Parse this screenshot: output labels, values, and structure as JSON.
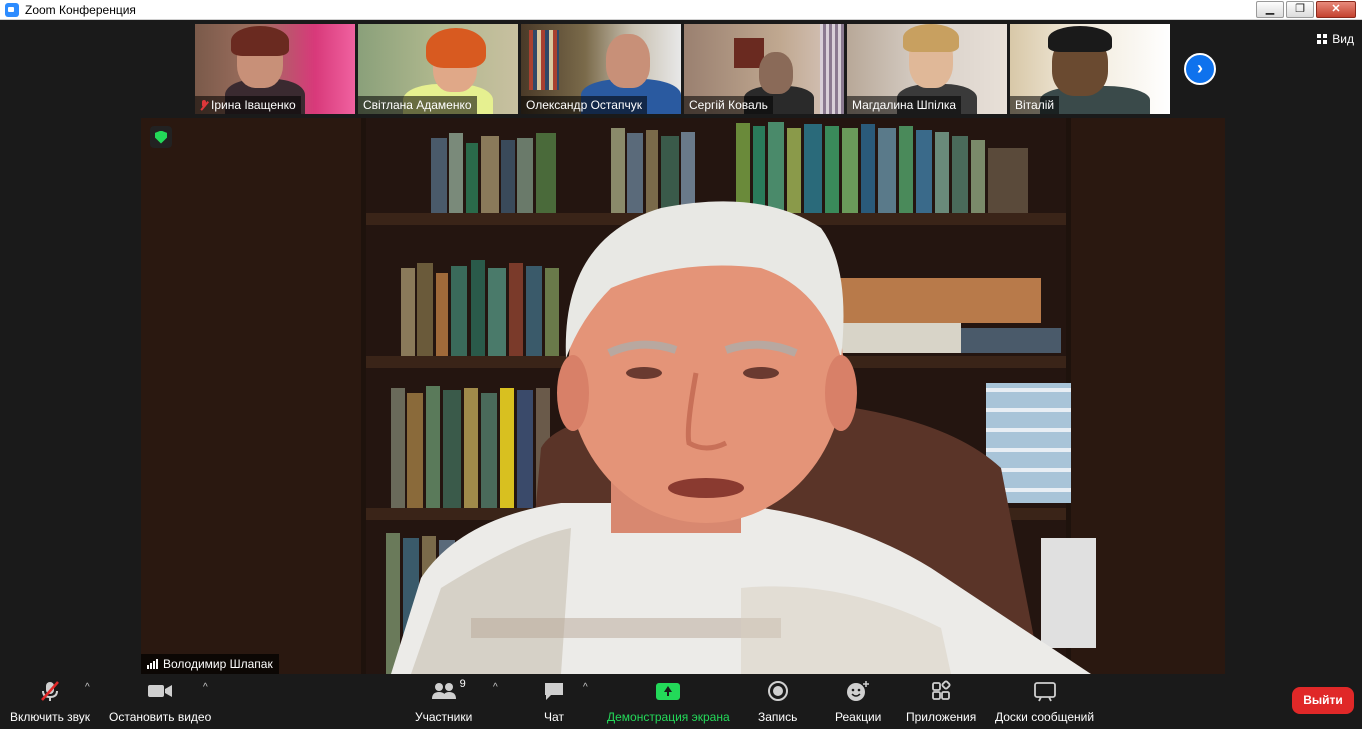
{
  "window": {
    "title": "Zoom Конференция",
    "minimize_icon": "minimize-icon",
    "restore_icon": "restore-icon",
    "close_icon": "close-icon"
  },
  "view_button": {
    "label": "Вид",
    "icon": "grid-icon"
  },
  "participants_strip": [
    {
      "name": "Ірина Іващенко",
      "muted": true
    },
    {
      "name": "Світлана Адаменко",
      "muted": false
    },
    {
      "name": "Олександр Остапчук",
      "muted": false
    },
    {
      "name": "Сергій Коваль",
      "muted": false
    },
    {
      "name": "Магдалина Шпілка",
      "muted": false
    },
    {
      "name": "Віталій",
      "muted": false
    }
  ],
  "main_speaker": {
    "name": "Володимир Шлапак",
    "encryption_icon": "shield-check-icon"
  },
  "toolbar": {
    "unmute_label": "Включить звук",
    "stop_video_label": "Остановить видео",
    "participants_label": "Участники",
    "participants_count": "9",
    "chat_label": "Чат",
    "share_label": "Демонстрация экрана",
    "record_label": "Запись",
    "reactions_label": "Реакции",
    "apps_label": "Приложения",
    "whiteboards_label": "Доски сообщений",
    "leave_label": "Выйти"
  },
  "colors": {
    "toolbar_bg": "#1a1a1a",
    "share_green": "#23d959",
    "leave_red": "#e02828",
    "accent_blue": "#0e72ed"
  }
}
